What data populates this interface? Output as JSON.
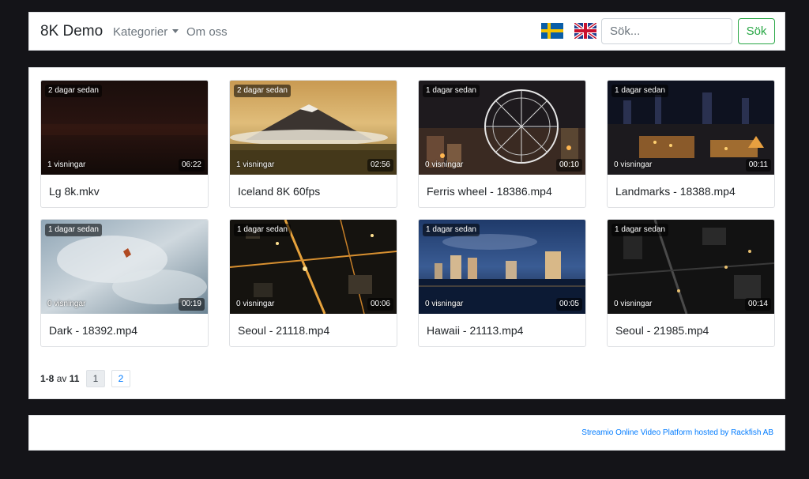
{
  "navbar": {
    "brand": "8K Demo",
    "categories_label": "Kategorier",
    "about_label": "Om oss",
    "search_placeholder": "Sök...",
    "search_button": "Sök"
  },
  "videos": [
    {
      "age": "2 dagar sedan",
      "views": "1 visningar",
      "duration": "06:22",
      "title": "Lg 8k.mkv"
    },
    {
      "age": "2 dagar sedan",
      "views": "1 visningar",
      "duration": "02:56",
      "title": "Iceland 8K 60fps"
    },
    {
      "age": "1 dagar sedan",
      "views": "0 visningar",
      "duration": "00:10",
      "title": "Ferris wheel - 18386.mp4"
    },
    {
      "age": "1 dagar sedan",
      "views": "0 visningar",
      "duration": "00:11",
      "title": "Landmarks - 18388.mp4"
    },
    {
      "age": "1 dagar sedan",
      "views": "0 visningar",
      "duration": "00:19",
      "title": "Dark - 18392.mp4"
    },
    {
      "age": "1 dagar sedan",
      "views": "0 visningar",
      "duration": "00:06",
      "title": "Seoul - 21118.mp4"
    },
    {
      "age": "1 dagar sedan",
      "views": "0 visningar",
      "duration": "00:05",
      "title": "Hawaii - 21113.mp4"
    },
    {
      "age": "1 dagar sedan",
      "views": "0 visningar",
      "duration": "00:14",
      "title": "Seoul - 21985.mp4"
    }
  ],
  "pagination": {
    "range": "1-8",
    "of_text": "av",
    "total": "11",
    "pages": [
      "1",
      "2"
    ]
  },
  "footer": {
    "link_text": "Streamio Online Video Platform hosted by Rackfish AB"
  }
}
